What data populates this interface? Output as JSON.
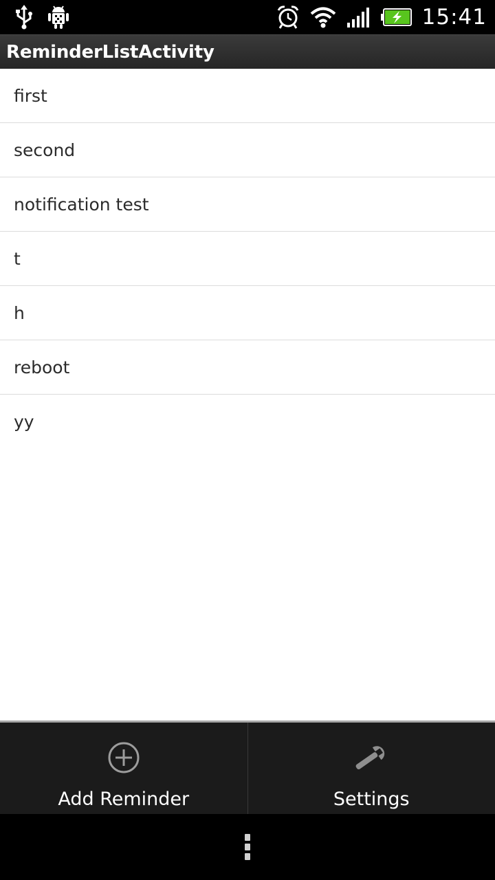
{
  "status_bar": {
    "left_icons": [
      "usb-icon",
      "android-debug-icon"
    ],
    "right_icons": [
      "alarm-icon",
      "wifi-icon",
      "signal-icon",
      "battery-charging-icon"
    ],
    "time": "15:41"
  },
  "title_bar": {
    "title": "ReminderListActivity"
  },
  "reminders": [
    {
      "label": "first"
    },
    {
      "label": "second"
    },
    {
      "label": "notification test"
    },
    {
      "label": "t"
    },
    {
      "label": "h"
    },
    {
      "label": "reboot"
    },
    {
      "label": "yy"
    }
  ],
  "action_bar": {
    "add_label": "Add Reminder",
    "add_icon": "add-circle-icon",
    "settings_label": "Settings",
    "settings_icon": "wrench-icon"
  },
  "nav_bar": {
    "menu_icon": "overflow-menu-icon"
  },
  "colors": {
    "battery_fill": "#58c51e"
  }
}
